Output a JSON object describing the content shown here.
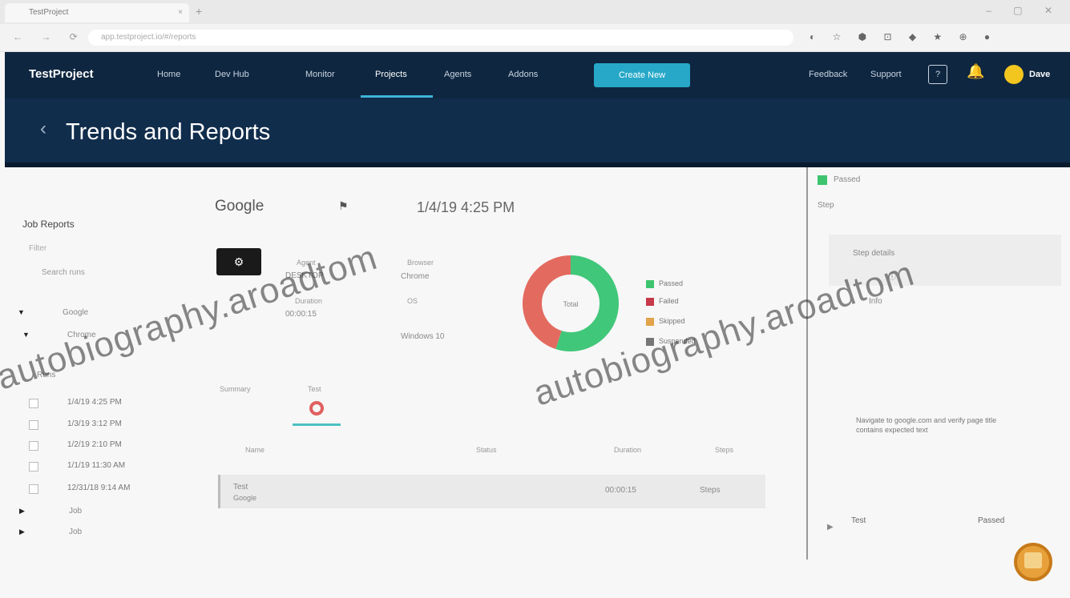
{
  "browser": {
    "tab_title": "TestProject",
    "tab_close": "×",
    "new_tab": "+",
    "window_controls": "– ▢ ✕",
    "nav_buttons": "← → ⟳",
    "url": "app.testproject.io/#/reports"
  },
  "topnav": {
    "logo": "TestProject",
    "items": [
      "Home",
      "Dev Hub",
      "Monitor",
      "Projects",
      "Agents",
      "Addons"
    ],
    "active_item": "Projects",
    "cta_label": "Create New",
    "right_items": [
      "Feedback",
      "Support"
    ],
    "help_label": "?",
    "user_name": "Dave"
  },
  "page": {
    "back_icon": "‹",
    "title": "Trends and Reports"
  },
  "sidebar": {
    "title": "Job Reports",
    "subtitle": "Filter",
    "filter_placeholder": "Search runs",
    "tree": [
      "Google",
      "Chrome",
      "Runs"
    ],
    "runs": [
      "1/4/19 4:25 PM",
      "1/3/19 3:12 PM",
      "1/2/19 2:10 PM",
      "1/1/19 11:30 AM",
      "12/31/18 9:14 AM"
    ],
    "jobs": [
      "Job",
      "Job"
    ]
  },
  "main": {
    "suite_name": "Google",
    "suite_flag": "⚑",
    "suite_date": "1/4/19 4:25 PM",
    "run_icon": "⚙",
    "fields": {
      "agent_label": "Agent",
      "agent_value": "DESKTOP",
      "duration_label": "Duration",
      "duration_value": "00:00:15",
      "browser_label": "Browser",
      "browser_value": "Chrome",
      "os_label": "OS",
      "os_value": "Windows 10"
    },
    "chart_center_label": "Total",
    "legend": [
      "Passed",
      "Failed",
      "Skipped",
      "Suspended"
    ],
    "subtabs": [
      "Summary",
      "Test"
    ],
    "table_headers": [
      "Name",
      "Status",
      "Duration",
      "Steps"
    ],
    "row": {
      "name": "Test",
      "sub": "Google",
      "duration": "00:00:15",
      "steps": "Steps"
    }
  },
  "rightpanel": {
    "status": "Passed",
    "heading": "Step",
    "box_title": "Step details",
    "info": "Info",
    "desc": "Navigate to google.com and verify page title contains expected text",
    "footer_left": "Test",
    "footer_right": "Passed"
  },
  "chart_data": {
    "type": "pie",
    "labels": [
      "Passed",
      "Failed"
    ],
    "values": [
      55,
      45
    ],
    "colors": [
      "#41c77a",
      "#e36a5f"
    ]
  },
  "watermark": "autobiography.aroadtom"
}
